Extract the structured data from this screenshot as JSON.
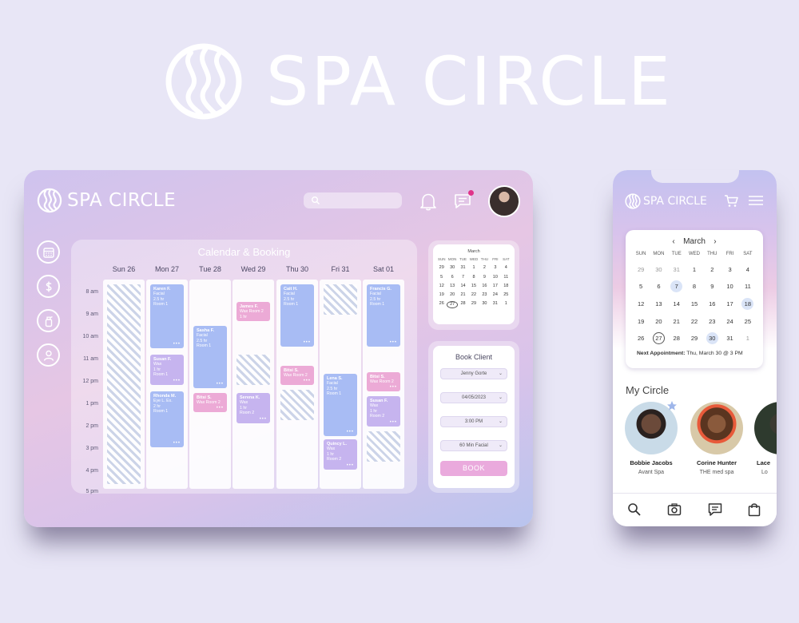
{
  "brand": {
    "name": "SPA CIRCLE"
  },
  "desktop": {
    "calendar_title": "Calendar & Booking",
    "days": [
      "Sun 26",
      "Mon 27",
      "Tue 28",
      "Wed 29",
      "Thu 30",
      "Fri 31",
      "Sat 01"
    ],
    "times": [
      "8 am",
      "9 am",
      "10 am",
      "11 am",
      "12 pm",
      "1 pm",
      "2 pm",
      "3 pm",
      "4 pm",
      "5 pm"
    ],
    "appointments": [
      {
        "name": "Karen F.",
        "l1": "Facial",
        "l2": "2.5 hr",
        "l3": "Room 1"
      },
      {
        "name": "Susan F.",
        "l1": "Wax",
        "l2": "1 hr",
        "l3": "Room 1"
      },
      {
        "name": "Rhonda M.",
        "l1": "Eye L. Ex.",
        "l2": "2 hr",
        "l3": "Room 1"
      },
      {
        "name": "Sasha F.",
        "l1": "Facial",
        "l2": "2.5 hr",
        "l3": "Room 1"
      },
      {
        "name": "Bitsi S.",
        "l1": "Wax Room 2",
        "l2": "",
        "l3": ""
      },
      {
        "name": "James F.",
        "l1": "Wax Room 2",
        "l2": "1 hr",
        "l3": ""
      },
      {
        "name": "Serena K.",
        "l1": "Wax",
        "l2": "1 hr",
        "l3": "Room 2"
      },
      {
        "name": "Cait H.",
        "l1": "Facial",
        "l2": "2.5 hr",
        "l3": "Room 1"
      },
      {
        "name": "Bitsi S.",
        "l1": "Wax Room 2",
        "l2": "",
        "l3": ""
      },
      {
        "name": "Lena S.",
        "l1": "Facial",
        "l2": "2.5 hr",
        "l3": "Room 1"
      },
      {
        "name": "Quincy L.",
        "l1": "Wax",
        "l2": "1 hr",
        "l3": "Room 2"
      },
      {
        "name": "Francis G.",
        "l1": "Facial",
        "l2": "2.5 hr",
        "l3": "Room 1"
      },
      {
        "name": "Bitsi S.",
        "l1": "Wax Room 2",
        "l2": "",
        "l3": ""
      },
      {
        "name": "Susan F.",
        "l1": "Wax",
        "l2": "1 hr",
        "l3": "Room 2"
      }
    ],
    "more_dots": "•••",
    "mini_calendar": {
      "month": "March",
      "weekdays": [
        "SUN",
        "MON",
        "TUE",
        "WED",
        "THU",
        "FRI",
        "SAT"
      ],
      "dates": [
        "29",
        "30",
        "31",
        "1",
        "2",
        "3",
        "4",
        "5",
        "6",
        "7",
        "8",
        "9",
        "10",
        "11",
        "12",
        "13",
        "14",
        "15",
        "16",
        "17",
        "18",
        "19",
        "20",
        "21",
        "22",
        "23",
        "24",
        "25",
        "26",
        "27",
        "28",
        "29",
        "30",
        "31",
        "1"
      ]
    },
    "book_client": {
      "title": "Book Client",
      "client": "Jenny Gorte",
      "date": "04/05/2023",
      "time": "3:00 PM",
      "service": "60 Min Facial",
      "button": "BOOK"
    }
  },
  "phone": {
    "calendar": {
      "month": "March",
      "prev": "‹",
      "next": "›",
      "weekdays": [
        "SUN",
        "MON",
        "TUE",
        "WED",
        "THU",
        "FRI",
        "SAT"
      ],
      "dates": [
        "29",
        "30",
        "31",
        "1",
        "2",
        "3",
        "4",
        "5",
        "6",
        "7",
        "8",
        "9",
        "10",
        "11",
        "12",
        "13",
        "14",
        "15",
        "16",
        "17",
        "18",
        "19",
        "20",
        "21",
        "22",
        "23",
        "24",
        "25",
        "26",
        "27",
        "28",
        "29",
        "30",
        "31",
        "1"
      ],
      "next_label": "Next Appointment:",
      "next_value": " Thu, March 30 @ 3 PM"
    },
    "my_circle_title": "My Circle",
    "circle": [
      {
        "name": "Bobbie Jacobs",
        "spa": "Avant Spa"
      },
      {
        "name": "Corine Hunter",
        "spa": "THE med spa"
      },
      {
        "name": "Lace",
        "spa": "Lo"
      }
    ]
  }
}
